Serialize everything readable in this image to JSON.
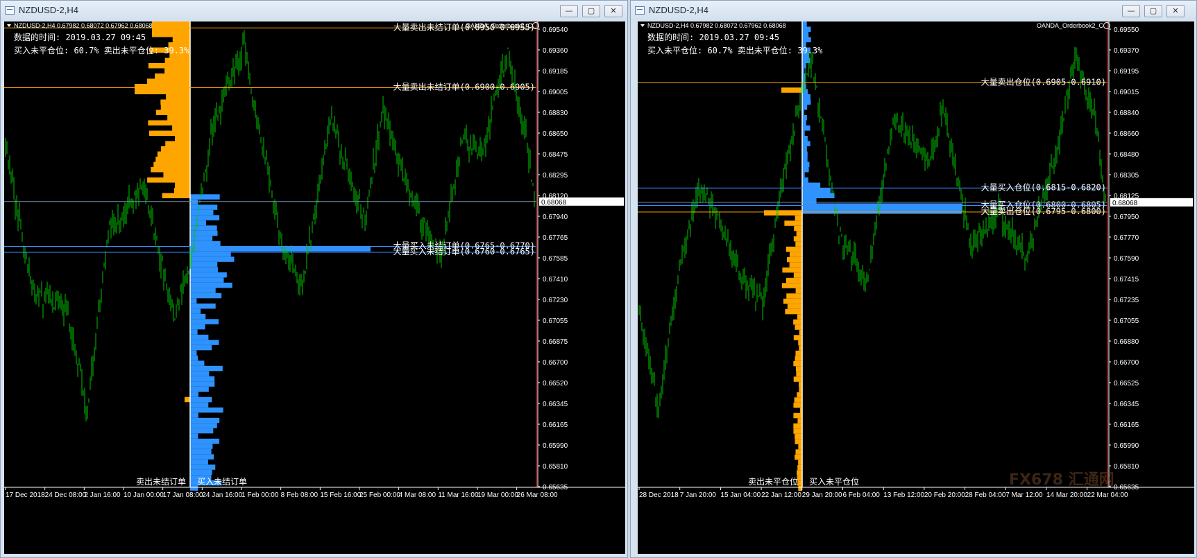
{
  "windows": [
    {
      "title": "NZDUSD-2,H4",
      "info_line": "NZDUSD-2,H4  0.67982 0.68072 0.67962 0.68068",
      "indicator_name": "OANDA_Orderbook2_C",
      "data_time": "数据的时间: 2019.03.27 09:45",
      "positions_text": "买入未平仓位: 60.7% 卖出未平仓位: 39.3%",
      "levels": [
        {
          "label": "大量卖出未结订单(0.6950-0.6955)",
          "price": 0.6955,
          "color": "#ffa500"
        },
        {
          "label": "大量卖出未结订单(0.6900-0.6905)",
          "price": 0.6904,
          "color": "#ffa500"
        },
        {
          "label": "大量买入未结订单(0.6765-0.6770)",
          "price": 0.67685,
          "color": "#3b8cff"
        },
        {
          "label": "大量买入未结订单(0.6760-0.6765)",
          "price": 0.67635,
          "color": "#3b8cff"
        }
      ],
      "current_price": "0.68068",
      "bottom_left_label": "卖出未结订单",
      "bottom_right_label": "买入未结订单",
      "price_ticks": [
        "0.69540",
        "0.69360",
        "0.69185",
        "0.69005",
        "0.68830",
        "0.68650",
        "0.68475",
        "0.68295",
        "0.68120",
        "0.67940",
        "0.67765",
        "0.67585",
        "0.67410",
        "0.67230",
        "0.67055",
        "0.66875",
        "0.66700",
        "0.66520",
        "0.66345",
        "0.66165",
        "0.65990",
        "0.65810",
        "0.65635"
      ],
      "time_ticks": [
        "17 Dec 2018",
        "24 Dec 08:00",
        "2 Jan 16:00",
        "10 Jan 00:00",
        "17 Jan 08:00",
        "24 Jan 16:00",
        "1 Feb 00:00",
        "8 Feb 08:00",
        "15 Feb 16:00",
        "25 Feb 00:00",
        "4 Mar 08:00",
        "11 Mar 16:00",
        "19 Mar 00:00",
        "26 Mar 08:00"
      ]
    },
    {
      "title": "NZDUSD-2,H4",
      "info_line": "NZDUSD-2,H4  0.67982 0.68072 0.67962 0.68068",
      "indicator_name": "OANDA_Orderbook2_C",
      "data_time": "数据的时间: 2019.03.27 09:45",
      "positions_text": "买入未平仓位: 60.7% 卖出未平仓位: 39.3%",
      "levels": [
        {
          "label": "大量卖出仓位(0.6905-0.6910)",
          "price": 0.6909,
          "color": "#ffa500"
        },
        {
          "label": "大量买入仓位(0.6815-0.6820)",
          "price": 0.6819,
          "color": "#3b8cff"
        },
        {
          "label": "大量买入仓位(0.6800-0.6805)",
          "price": 0.6804,
          "color": "#3b8cff"
        },
        {
          "label": "大量卖出仓位(0.6795-0.6800)",
          "price": 0.67985,
          "color": "#ffa500"
        }
      ],
      "current_price": "0.68068",
      "bottom_left_label": "卖出未平仓位",
      "bottom_right_label": "买入未平仓位",
      "price_ticks": [
        "0.69550",
        "0.69370",
        "0.69195",
        "0.69015",
        "0.68840",
        "0.68660",
        "0.68480",
        "0.68305",
        "0.68125",
        "0.67950",
        "0.67770",
        "0.67590",
        "0.67415",
        "0.67235",
        "0.67055",
        "0.66880",
        "0.66700",
        "0.66525",
        "0.66345",
        "0.66165",
        "0.65990",
        "0.65810",
        "0.65635"
      ],
      "time_ticks": [
        "28 Dec 2018",
        "7 Jan 20:00",
        "15 Jan 04:00",
        "22 Jan 12:00",
        "29 Jan 20:00",
        "6 Feb 04:00",
        "13 Feb 12:00",
        "20 Feb 20:00",
        "28 Feb 04:00",
        "7 Mar 12:00",
        "14 Mar 20:00",
        "22 Mar 04:00"
      ]
    }
  ],
  "watermark": "FX678 汇通网",
  "colors": {
    "sell": "#ffa500",
    "buy": "#2e93ff",
    "candle": "#00c400",
    "text": "#ffffff"
  }
}
